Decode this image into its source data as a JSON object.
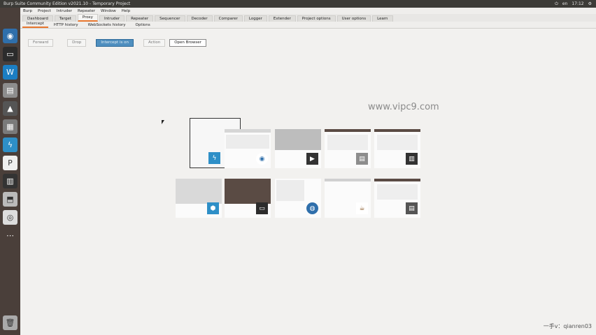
{
  "window": {
    "title": "Burp Suite Community Edition v2021.10 - Temporary Project"
  },
  "tray": {
    "items": [
      "en",
      "wifi",
      "vol",
      "bat"
    ],
    "clock": "17:12"
  },
  "menubar": {
    "items": [
      "Burp",
      "Project",
      "Intruder",
      "Repeater",
      "Window",
      "Help"
    ]
  },
  "tabs": [
    "Dashboard",
    "Target",
    "Proxy",
    "Intruder",
    "Repeater",
    "Sequencer",
    "Decoder",
    "Comparer",
    "Logger",
    "Extender",
    "Project options",
    "User options",
    "Learn"
  ],
  "subtabs": [
    "Intercept",
    "HTTP history",
    "WebSockets history",
    "Options"
  ],
  "toolbar": {
    "forward": "Forward",
    "drop": "Drop",
    "intercept": "Intercept is on",
    "action": "Action",
    "open_browser": "Open Browser"
  },
  "watermark": "www.vipc9.com",
  "footer_note": "一手v：qianren03",
  "launcher_icons": [
    "ubuntu-icon",
    "terminal-icon",
    "wps-icon",
    "folder-icon",
    "inkscape-icon",
    "disk-icon",
    "burp-icon",
    "p-icon",
    "clapper-icon",
    "usb-icon",
    "dvd-icon",
    "more-icon",
    "trash-icon"
  ],
  "colors": {
    "accent": "#e8772e",
    "burp_blue": "#2e8fc7",
    "launcher_bg": "#4a3f3a"
  }
}
